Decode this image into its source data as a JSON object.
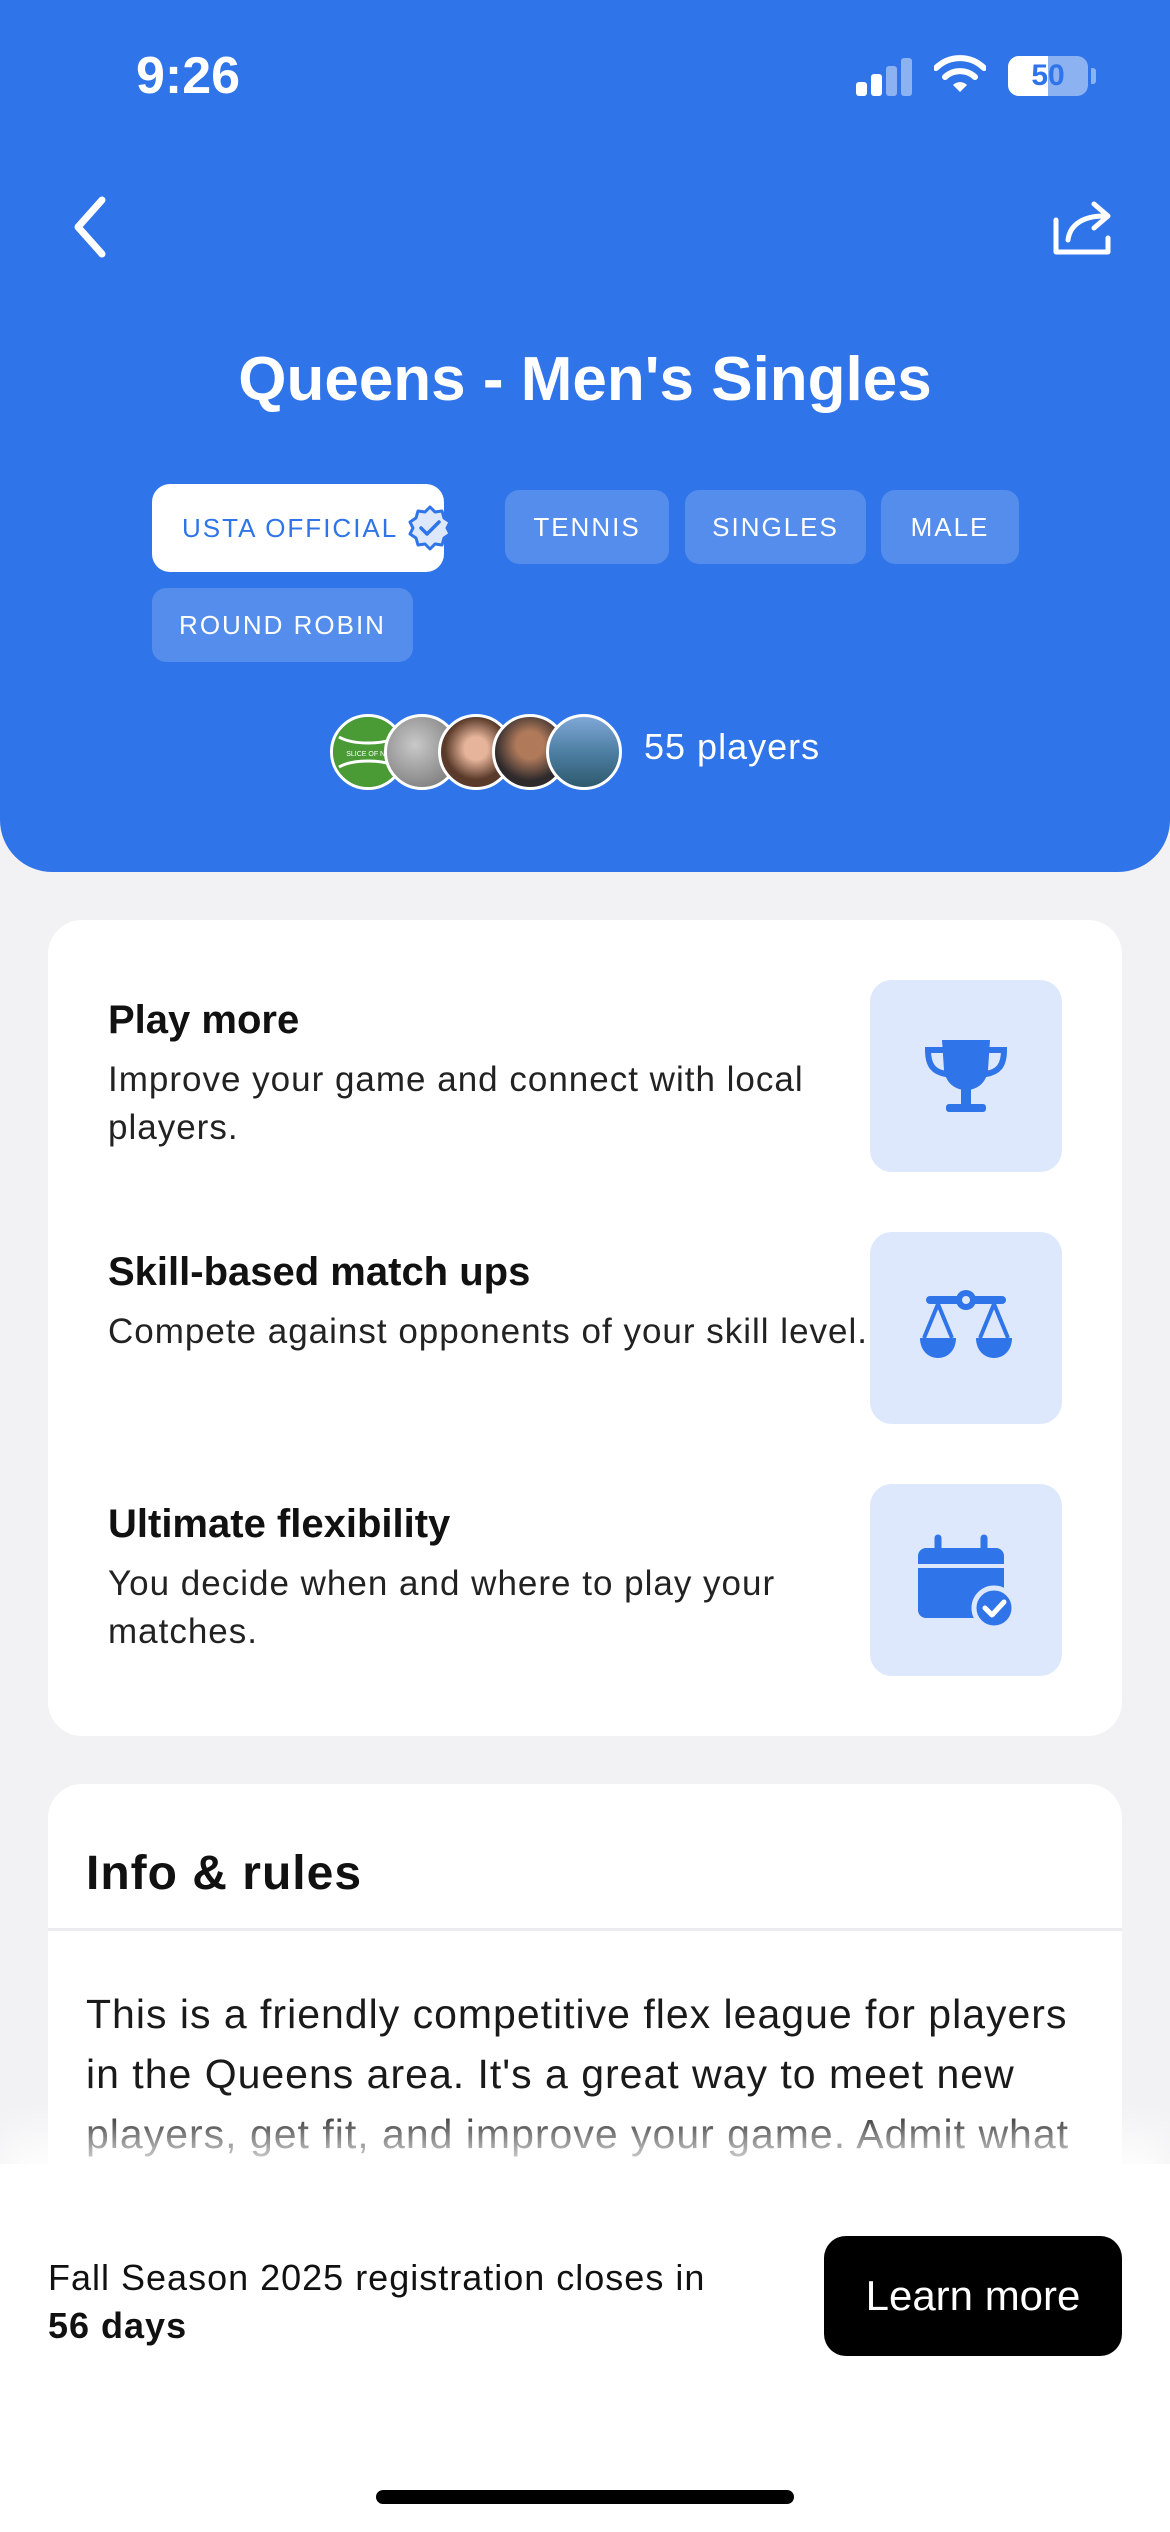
{
  "status_bar": {
    "time": "9:26",
    "battery": "50"
  },
  "header": {
    "title": "Queens - Men's Singles",
    "tags": {
      "official": "USTA OFFICIAL",
      "sport": "TENNIS",
      "format": "SINGLES",
      "gender": "MALE",
      "type": "ROUND ROBIN"
    },
    "players_count": "55 players",
    "avatar_logo_text": "SLICE OF NE"
  },
  "features": [
    {
      "title": "Play more",
      "desc": "Improve your game and connect with local players.",
      "icon": "trophy-icon"
    },
    {
      "title": "Skill-based match ups",
      "desc": "Compete against opponents of your skill level.",
      "icon": "scale-icon"
    },
    {
      "title": "Ultimate flexibility",
      "desc": "You decide when and where to play your matches.",
      "icon": "calendar-check-icon"
    }
  ],
  "info": {
    "title": "Info & rules",
    "body": "This is a friendly competitive flex league for players in the Queens area. It's a great way to meet new players, get fit, and improve your game. Admit what you feel is tough and we work"
  },
  "registration": {
    "text": "Fall Season 2025 registration closes in",
    "days": "56 days",
    "button": "Learn more"
  },
  "colors": {
    "brand": "#2f74e8",
    "icon_bg": "#dde8fc"
  }
}
